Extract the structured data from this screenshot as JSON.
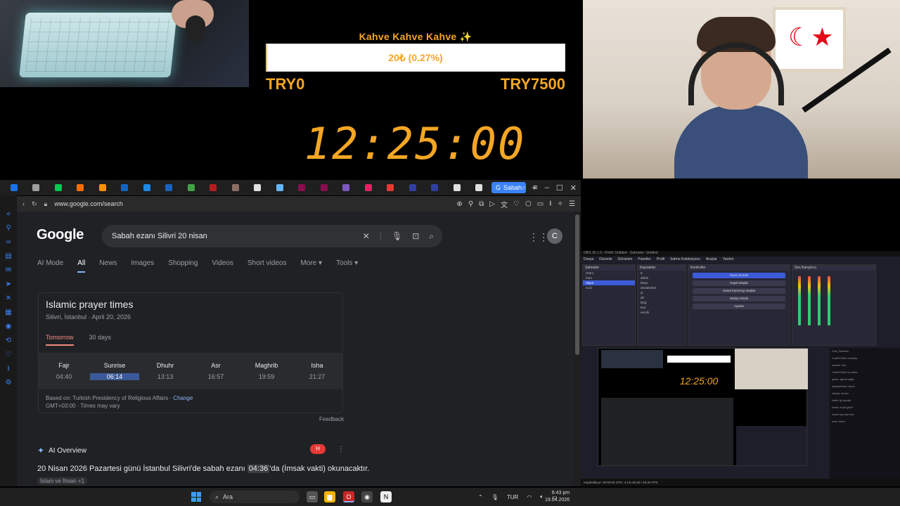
{
  "stream": {
    "goal_title": "Kahve Kahve Kahve ✨",
    "goal_progress_text": "20₺ (0.27%)",
    "goal_progress_fraction": 0.0027,
    "goal_min": "TRY0",
    "goal_max": "TRY7500",
    "timer": "12:25:00"
  },
  "browser": {
    "active_tab_label": "Sabah",
    "url": "www.google.com/search",
    "tab_icon_colors": [
      "#1a73e8",
      "#9e9e9e",
      "#00c853",
      "#ff6d00",
      "#ff9100",
      "#1565c0",
      "#1e88e5",
      "#1565c0",
      "#43a047",
      "#b71c1c",
      "#8d6e63",
      "#e0e0e0",
      "#64b5f6",
      "#880e4f",
      "#880e4f",
      "#7e57c2",
      "#e91e63",
      "#e53935",
      "#303f9f",
      "#303f9f",
      "#e0e0e0",
      "#e0e0e0"
    ]
  },
  "google": {
    "logo": "Google",
    "query": "Sabah ezanı Silivri 20 nisan",
    "avatar_letter": "C",
    "tabs": [
      "AI Mode",
      "All",
      "News",
      "Images",
      "Shopping",
      "Videos",
      "Short videos",
      "More ▾",
      "Tools ▾"
    ],
    "active_tab": "All",
    "prayer": {
      "title": "Islamic prayer times",
      "subtitle": "Silivri, İstanbul · April 20, 2026",
      "tab_tomorrow": "Tomorrow",
      "tab_30days": "30 days",
      "times": [
        {
          "name": "Fajr",
          "time": "04:40"
        },
        {
          "name": "Sunrise",
          "time": "06:14"
        },
        {
          "name": "Dhuhr",
          "time": "13:13"
        },
        {
          "name": "Asr",
          "time": "16:57"
        },
        {
          "name": "Maghrib",
          "time": "19:59"
        },
        {
          "name": "Isha",
          "time": "21:27"
        }
      ],
      "source_text": "Based on: Turkish Presidency of Religious Affairs ·",
      "source_link": "Change",
      "timezone_text": "GMT+03:00 · Times may vary"
    },
    "feedback": "Feedback",
    "ai_overview_label": "AI Overview",
    "ai_badge": "H",
    "ai_text_before": "20 Nisan 2026 Pazartesi günü İstanbul Silivri'de sabah ezanı ",
    "ai_text_highlight": "04:36",
    "ai_text_after": "'da (İmsak vakti) okunacaktır.",
    "ai_source": "İslam ve İhsan +1"
  },
  "obs": {
    "title": "OBS 32.1.0 - Profil: Untitled - Sahneler: Untitled",
    "menu": [
      "Dosya",
      "Düzenle",
      "Görünüm",
      "Paneller",
      "Profil",
      "Sahne Koleksiyonu",
      "Araçlar",
      "Yardım"
    ],
    "scenes_header": "Sahneler",
    "scenes": [
      "Outro",
      "Intro",
      "Yayın",
      "Cozi"
    ],
    "active_scene": "Yayın",
    "sources_header": "Kaynaklar",
    "sources": [
      "8",
      "alerts",
      "blurp",
      "donatecket",
      "yt",
      "alt",
      "bing",
      "text",
      "ext.dk"
    ],
    "controls_header": "Kontroller",
    "controls": [
      "Yayını Durdur",
      "Kaydı Başlat",
      "Sanal Kamerayı Başlat",
      "Stüdyo Modu",
      "Ayarlar"
    ],
    "mixer_header": "Ses Karıştırıcı",
    "status": "Kaydediliyor: 00:00:00   CPU: 4.1%   60.00 / 60.00 FPS",
    "chat_lines": [
      "Chat_Gurethan",
      "CodeDOSink: merhaba",
      "orenefe: 1lira",
      "CodeDOSink: bu arada",
      "gizem: ağzına sağlık",
      "aykutpehlivan: hayırlı",
      "zeynep: devam",
      "hilalkt: iyi yayınlar",
      "barisk: müzik güzel",
      "murat: kaç saat oldu",
      "emre: bravo"
    ]
  },
  "taskbar": {
    "search_label": "Ara",
    "language": "TUR",
    "time": "6:43 pm",
    "date": "19.04.2026"
  }
}
